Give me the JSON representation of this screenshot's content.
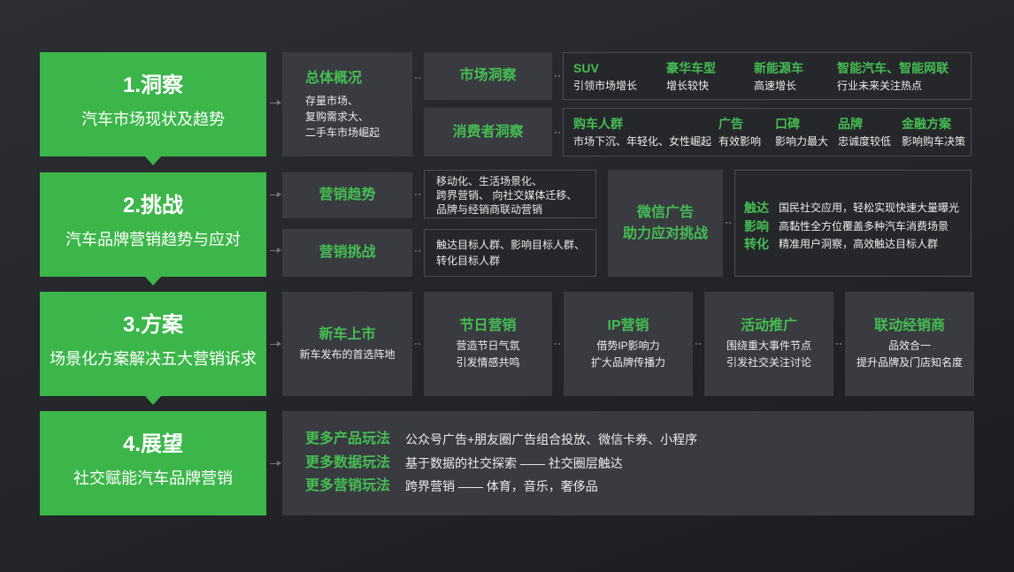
{
  "colors": {
    "background": "#222428",
    "step_green": "#3cb64a",
    "accent_text": "#45bd52",
    "panel_fill": "#393b41",
    "outline_border": "#4a4d55",
    "body_text": "#e9e9e9"
  },
  "icons": {
    "step_connector": "triangle-down-icon",
    "row_connector": "arrow-right-icon",
    "item_connector": "dots-connector-icon"
  },
  "steps": [
    {
      "title": "1.洞察",
      "subtitle": "汽车市场现状及趋势"
    },
    {
      "title": "2.挑战",
      "subtitle": "汽车品牌营销趋势与应对"
    },
    {
      "title": "3.方案",
      "subtitle": "场景化方案解决五大营销诉求"
    },
    {
      "title": "4.展望",
      "subtitle": "社交赋能汽车品牌营销"
    }
  ],
  "insight": {
    "overview": {
      "title": "总体概况",
      "lines": [
        "存量市场、",
        "复购需求大、",
        "二手车市场崛起"
      ]
    },
    "market": {
      "label": "市场洞察",
      "items": [
        {
          "head": "SUV",
          "text": "引领市场增长"
        },
        {
          "head": "豪华车型",
          "text": "增长较快"
        },
        {
          "head": "新能源车",
          "text": "高速增长"
        },
        {
          "head": "智能汽车、智能网联",
          "text": "行业未来关注热点"
        }
      ]
    },
    "consumer": {
      "label": "消费者洞察",
      "items": [
        {
          "head": "购车人群",
          "text": "市场下沉、年轻化、女性崛起"
        },
        {
          "head": "广告",
          "text": "有效影响"
        },
        {
          "head": "口碑",
          "text": "影响力最大"
        },
        {
          "head": "品牌",
          "text": "忠诚度较低"
        },
        {
          "head": "金融方案",
          "text": "影响购车决策"
        }
      ]
    }
  },
  "challenge": {
    "trend": {
      "label": "营销趋势",
      "lines": [
        "移动化、生活场景化、",
        "跨界营销、 向社交媒体迁移、",
        "品牌与经销商联动营销"
      ]
    },
    "problem": {
      "label": "营销挑战",
      "lines": [
        "触达目标人群、影响目标人群、",
        "转化目标人群"
      ]
    },
    "wechat": {
      "lines": [
        "微信广告",
        "助力应对挑战"
      ]
    },
    "points": [
      {
        "head": "触达",
        "text": "国民社交应用，轻松实现快速大量曝光"
      },
      {
        "head": "影响",
        "text": "高黏性全方位覆盖多种汽车消费场景"
      },
      {
        "head": "转化",
        "text": "精准用户洞察，高效触达目标人群"
      }
    ]
  },
  "solution": {
    "cards": [
      {
        "title": "新车上市",
        "lines": [
          "新车发布的首选阵地"
        ]
      },
      {
        "title": "节日营销",
        "lines": [
          "营造节日气氛",
          "引发情感共鸣"
        ]
      },
      {
        "title": "IP营销",
        "lines": [
          "借势IP影响力",
          "扩大品牌传播力"
        ]
      },
      {
        "title": "活动推广",
        "lines": [
          "围绕重大事件节点",
          "引发社交关注讨论"
        ]
      },
      {
        "title": "联动经销商",
        "lines": [
          "品效合一",
          "提升品牌及门店知名度"
        ]
      }
    ]
  },
  "outlook": {
    "items": [
      {
        "head": "更多产品玩法",
        "text": "公众号广告+朋友圈广告组合投放、微信卡券、小程序"
      },
      {
        "head": "更多数据玩法",
        "text": "基于数据的社交探索 —— 社交圈层触达"
      },
      {
        "head": "更多营销玩法",
        "text": "跨界营销 —— 体育，音乐，奢侈品"
      }
    ]
  }
}
